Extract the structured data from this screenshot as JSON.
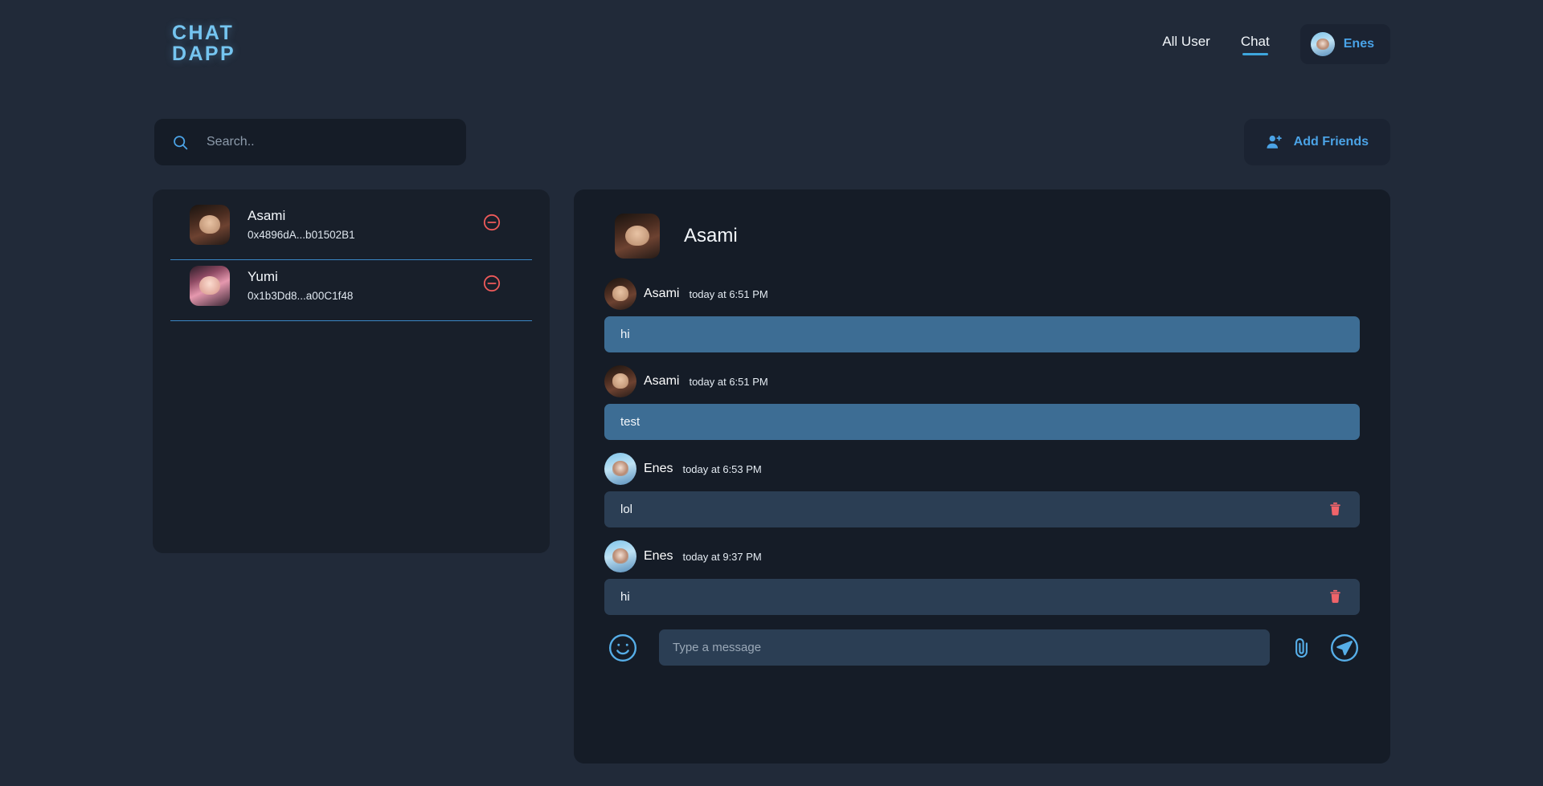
{
  "header": {
    "logo_line1": "CHAT",
    "logo_line2": "DAPP",
    "nav": [
      {
        "label": "All User",
        "active": false
      },
      {
        "label": "Chat",
        "active": true
      }
    ],
    "account": {
      "name": "Enes",
      "avatar": "enes-avatar"
    }
  },
  "toolbar": {
    "search_placeholder": "Search..",
    "search_value": "",
    "search_icon": "search-icon",
    "add_friends_label": "Add Friends",
    "add_friends_icon": "user-plus-icon"
  },
  "friends": [
    {
      "name": "Asami",
      "address": "0x4896dA...b01502B1",
      "avatar": "asami-avatar",
      "remove_icon": "minus-circle-icon"
    },
    {
      "name": "Yumi",
      "address": "0x1b3Dd8...a00C1f48",
      "avatar": "yumi-avatar",
      "remove_icon": "minus-circle-icon"
    }
  ],
  "chat": {
    "title": "Asami",
    "title_avatar": "asami-avatar",
    "messages": [
      {
        "author": "Asami",
        "time": "today at 6:51 PM",
        "text": "hi",
        "direction": "incoming",
        "avatar": "asami-avatar",
        "deletable": false
      },
      {
        "author": "Asami",
        "time": "today at 6:51 PM",
        "text": "test",
        "direction": "incoming",
        "avatar": "asami-avatar",
        "deletable": false
      },
      {
        "author": "Enes",
        "time": "today at 6:53 PM",
        "text": "lol",
        "direction": "outgoing",
        "avatar": "enes-avatar",
        "deletable": true
      },
      {
        "author": "Enes",
        "time": "today at 9:37 PM",
        "text": "hi",
        "direction": "outgoing",
        "avatar": "enes-avatar",
        "deletable": true
      }
    ],
    "composer": {
      "emoji_icon": "smiley-icon",
      "placeholder": "Type a message",
      "value": "",
      "attach_icon": "paperclip-icon",
      "send_icon": "send-icon"
    }
  },
  "colors": {
    "page_bg": "#212a39",
    "panel_bg": "#181f2a",
    "chat_bg": "#151c27",
    "accent_blue": "#4ba3e6",
    "logo_blue": "#75c5f0",
    "incoming_bubble": "#3d6d94",
    "outgoing_bubble": "#2b3e54",
    "danger_red": "#ee5a5a",
    "divider_blue": "#3a86c4"
  }
}
